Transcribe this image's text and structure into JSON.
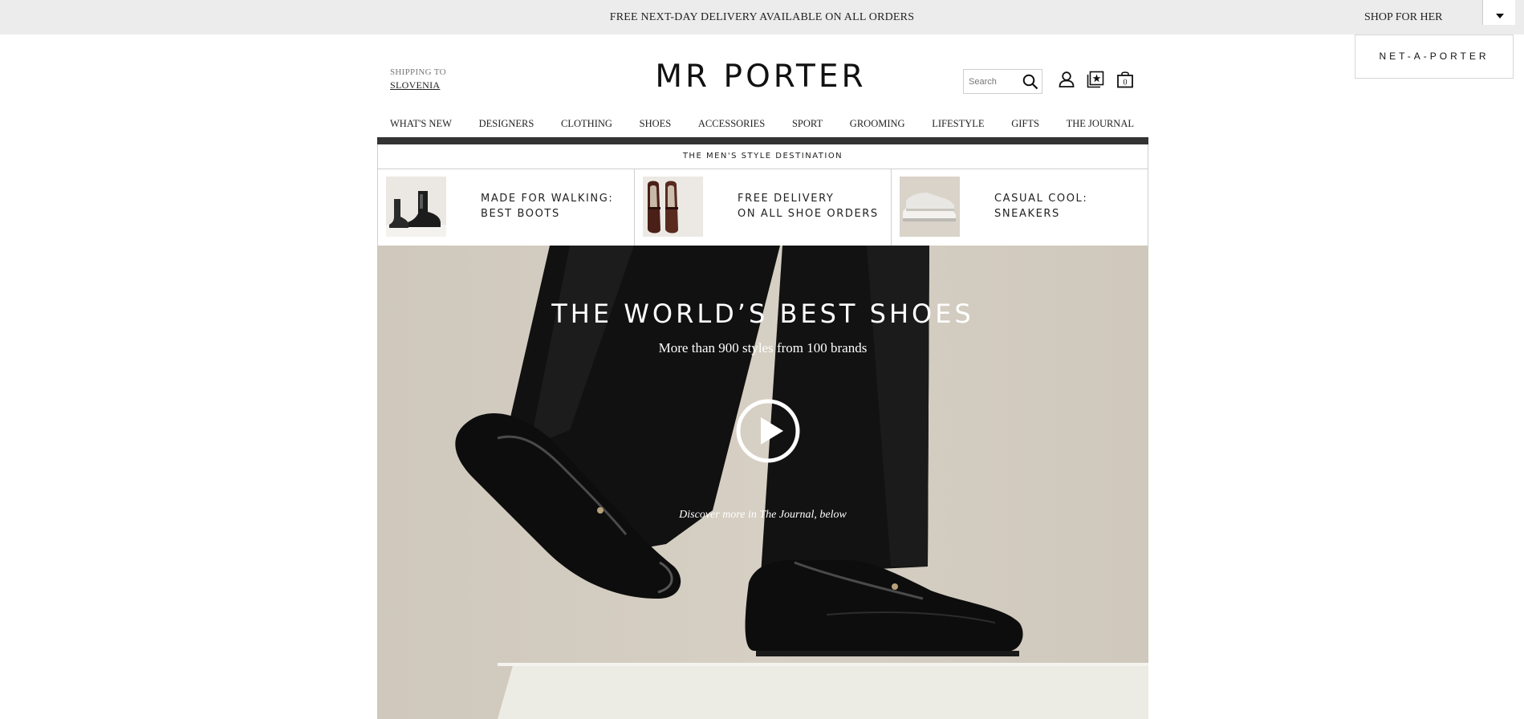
{
  "topbar": {
    "promo": "FREE NEXT-DAY DELIVERY AVAILABLE ON ALL ORDERS",
    "shop_for_her": "SHOP FOR HER"
  },
  "net_a_porter": "NET-A-PORTER",
  "shipping": {
    "label": "SHIPPING TO",
    "country": "SLOVENIA"
  },
  "logo": "MR PORTER",
  "search": {
    "placeholder": "Search"
  },
  "bag_count": "0",
  "nav": [
    "WHAT'S NEW",
    "DESIGNERS",
    "CLOTHING",
    "SHOES",
    "ACCESSORIES",
    "SPORT",
    "GROOMING",
    "LIFESTYLE",
    "GIFTS",
    "THE JOURNAL"
  ],
  "tagline": "THE MEN'S STYLE DESTINATION",
  "promos": [
    {
      "line1": "MADE FOR WALKING:",
      "line2": "BEST BOOTS"
    },
    {
      "line1": "FREE DELIVERY",
      "line2": "ON ALL SHOE ORDERS"
    },
    {
      "line1": "CASUAL COOL:",
      "line2": "SNEAKERS"
    }
  ],
  "hero": {
    "headline": "THE WORLD’S BEST SHOES",
    "subhead": "More than 900 styles from 100 brands",
    "discover": "Discover more in The Journal, below"
  },
  "colors": {
    "topbar_bg": "#ececec",
    "dark_band": "#333333",
    "hero_bg": "#d6cfc3",
    "text": "#222222"
  }
}
